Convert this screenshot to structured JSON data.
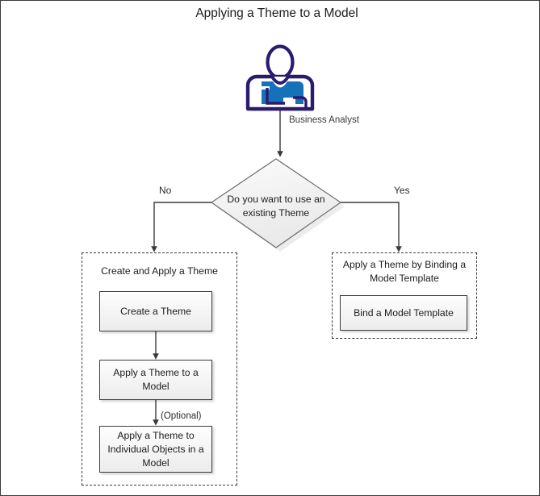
{
  "diagram": {
    "title": "Applying a Theme to a Model",
    "actor": {
      "icon": "business-analyst-person-icon",
      "label": "Business Analyst",
      "outline_color": "#2b1a6e",
      "body_color": "#1572b8"
    },
    "decision": {
      "text": "Do you want to use an existing Theme",
      "shape": "diamond",
      "fill_color": "#f1f1f1",
      "border_color": "#6b6b6b"
    },
    "branch_labels": {
      "no": "No",
      "yes": "Yes"
    },
    "connector_labels": {
      "optional": "(Optional)"
    },
    "groups": [
      {
        "id": "create-and-apply",
        "label": "Create and Apply a Theme",
        "border_style": "dashed",
        "steps": [
          "Create a Theme",
          "Apply a Theme to a Model",
          "Apply a Theme to Individual Objects in a Model"
        ]
      },
      {
        "id": "bind-template",
        "label": "Apply a Theme by Binding a Model Template",
        "border_style": "dashed",
        "steps": [
          "Bind a Model Template"
        ]
      }
    ],
    "colors": {
      "line": "#3a3a3a",
      "text": "#1c1c1c",
      "box_border": "#3d3d3d",
      "frame_border": "#3a3a3a"
    }
  }
}
